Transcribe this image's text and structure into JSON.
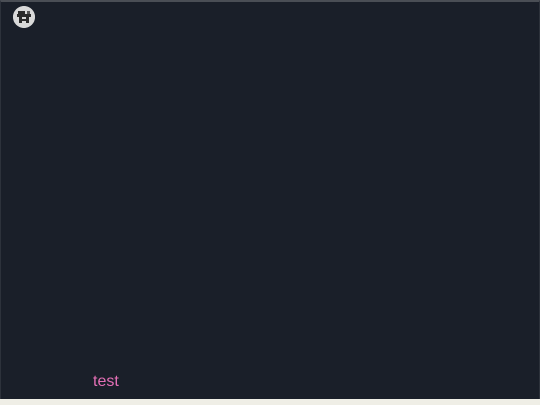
{
  "message": {
    "text": "test",
    "color": "#e36fb5"
  },
  "avatar": {
    "icon": "robot-avatar-icon"
  },
  "colors": {
    "background": "#1a1f29",
    "outer": "#efeee6"
  }
}
